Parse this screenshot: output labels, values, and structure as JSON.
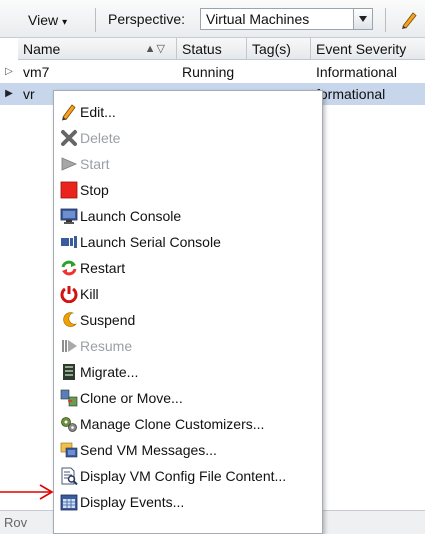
{
  "toolbar": {
    "view_label": "View",
    "view_caret": "▾",
    "perspective_label": "Perspective:",
    "perspective_value": "Virtual Machines"
  },
  "table": {
    "columns": {
      "name": "Name",
      "status": "Status",
      "tags": "Tag(s)",
      "event_severity": "Event Severity"
    },
    "sort_indicator": "▲▽",
    "rows": [
      {
        "name": "vm7",
        "status": "Running",
        "tags": "",
        "event_severity": "Informational"
      },
      {
        "name": "vr",
        "status": "",
        "tags": "",
        "event_severity": "formational"
      }
    ],
    "expander_collapsed": "▷",
    "expander_selected": "▶"
  },
  "bottom_bar": {
    "partial_text": "Rov"
  },
  "context_menu": {
    "items": [
      {
        "label": "Edit...",
        "icon": "pencil-icon",
        "enabled": true
      },
      {
        "label": "Delete",
        "icon": "x-delete-icon",
        "enabled": false
      },
      {
        "label": "Start",
        "icon": "play-icon",
        "enabled": false
      },
      {
        "label": "Stop",
        "icon": "stop-icon",
        "enabled": true
      },
      {
        "label": "Launch Console",
        "icon": "monitor-icon",
        "enabled": true
      },
      {
        "label": "Launch Serial Console",
        "icon": "serial-console-icon",
        "enabled": true
      },
      {
        "label": "Restart",
        "icon": "restart-icon",
        "enabled": true
      },
      {
        "label": "Kill",
        "icon": "kill-icon",
        "enabled": true
      },
      {
        "label": "Suspend",
        "icon": "suspend-icon",
        "enabled": true
      },
      {
        "label": "Resume",
        "icon": "resume-icon",
        "enabled": false
      },
      {
        "label": "Migrate...",
        "icon": "migrate-icon",
        "enabled": true
      },
      {
        "label": "Clone or Move...",
        "icon": "clone-icon",
        "enabled": true
      },
      {
        "label": "Manage Clone Customizers...",
        "icon": "gears-icon",
        "enabled": true
      },
      {
        "label": "Send VM Messages...",
        "icon": "send-message-icon",
        "enabled": true
      },
      {
        "label": "Display VM Config File Content...",
        "icon": "config-file-icon",
        "enabled": true
      },
      {
        "label": "Display Events...",
        "icon": "calendar-icon",
        "enabled": true
      }
    ]
  },
  "colors": {
    "selected_row": "#c7d6ea",
    "stop_red": "#e8241c",
    "restart_green": "#2aa22a",
    "kill_red": "#d31212",
    "suspend_orange": "#f0a000",
    "annotation_red": "#e10000"
  }
}
